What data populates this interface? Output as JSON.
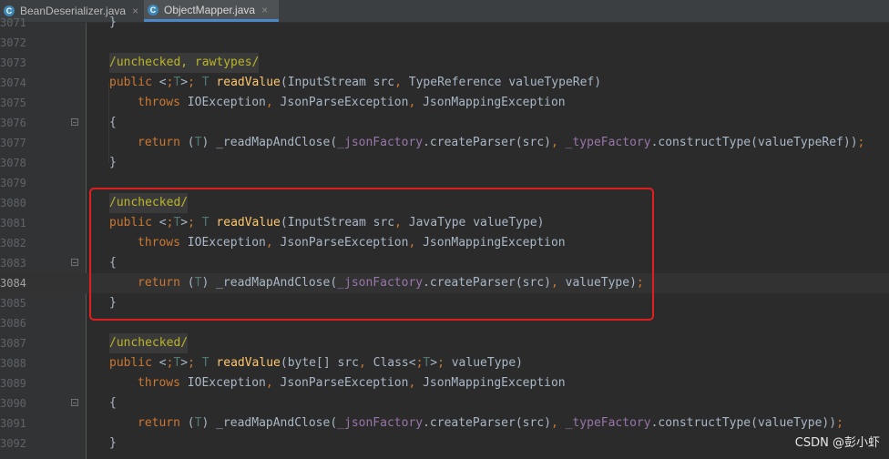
{
  "tabs": [
    {
      "label": "BeanDeserializer.java",
      "icon": "C",
      "active": false
    },
    {
      "label": "ObjectMapper.java",
      "icon": "C",
      "active": true
    }
  ],
  "tab_close_glyph": "×",
  "lines": [
    {
      "num": "3071",
      "code": "}"
    },
    {
      "num": "3072",
      "code": ""
    },
    {
      "num": "3073",
      "code": "/unchecked, rawtypes/"
    },
    {
      "num": "3074",
      "code": "public <T> T readValue(InputStream src, TypeReference valueTypeRef)"
    },
    {
      "num": "3075",
      "code": "throws IOException, JsonParseException, JsonMappingException"
    },
    {
      "num": "3076",
      "code": "{"
    },
    {
      "num": "3077",
      "code": "return (T) _readMapAndClose(_jsonFactory.createParser(src), _typeFactory.constructType(valueTypeRef));"
    },
    {
      "num": "3078",
      "code": "}"
    },
    {
      "num": "3079",
      "code": ""
    },
    {
      "num": "3080",
      "code": "/unchecked/"
    },
    {
      "num": "3081",
      "code": "public <T> T readValue(InputStream src, JavaType valueType)"
    },
    {
      "num": "3082",
      "code": "throws IOException, JsonParseException, JsonMappingException"
    },
    {
      "num": "3083",
      "code": "{"
    },
    {
      "num": "3084",
      "code": "return (T) _readMapAndClose(_jsonFactory.createParser(src), valueType);"
    },
    {
      "num": "3085",
      "code": "}"
    },
    {
      "num": "3086",
      "code": ""
    },
    {
      "num": "3087",
      "code": "/unchecked/"
    },
    {
      "num": "3088",
      "code": "public <T> T readValue(byte[] src, Class<T> valueType)"
    },
    {
      "num": "3089",
      "code": "throws IOException, JsonParseException, JsonMappingException"
    },
    {
      "num": "3090",
      "code": "{"
    },
    {
      "num": "3091",
      "code": "return (T) _readMapAndClose(_jsonFactory.createParser(src), _typeFactory.constructType(valueType));"
    },
    {
      "num": "3092",
      "code": "}"
    }
  ],
  "current_line": "3084",
  "watermark": "CSDN @彭小虾",
  "colors": {
    "background": "#2b2b2b",
    "keyword": "#cc7832",
    "method": "#ffc66d",
    "field": "#9876aa",
    "annotation": "#bbb529",
    "highlight_box": "#e0201f"
  }
}
